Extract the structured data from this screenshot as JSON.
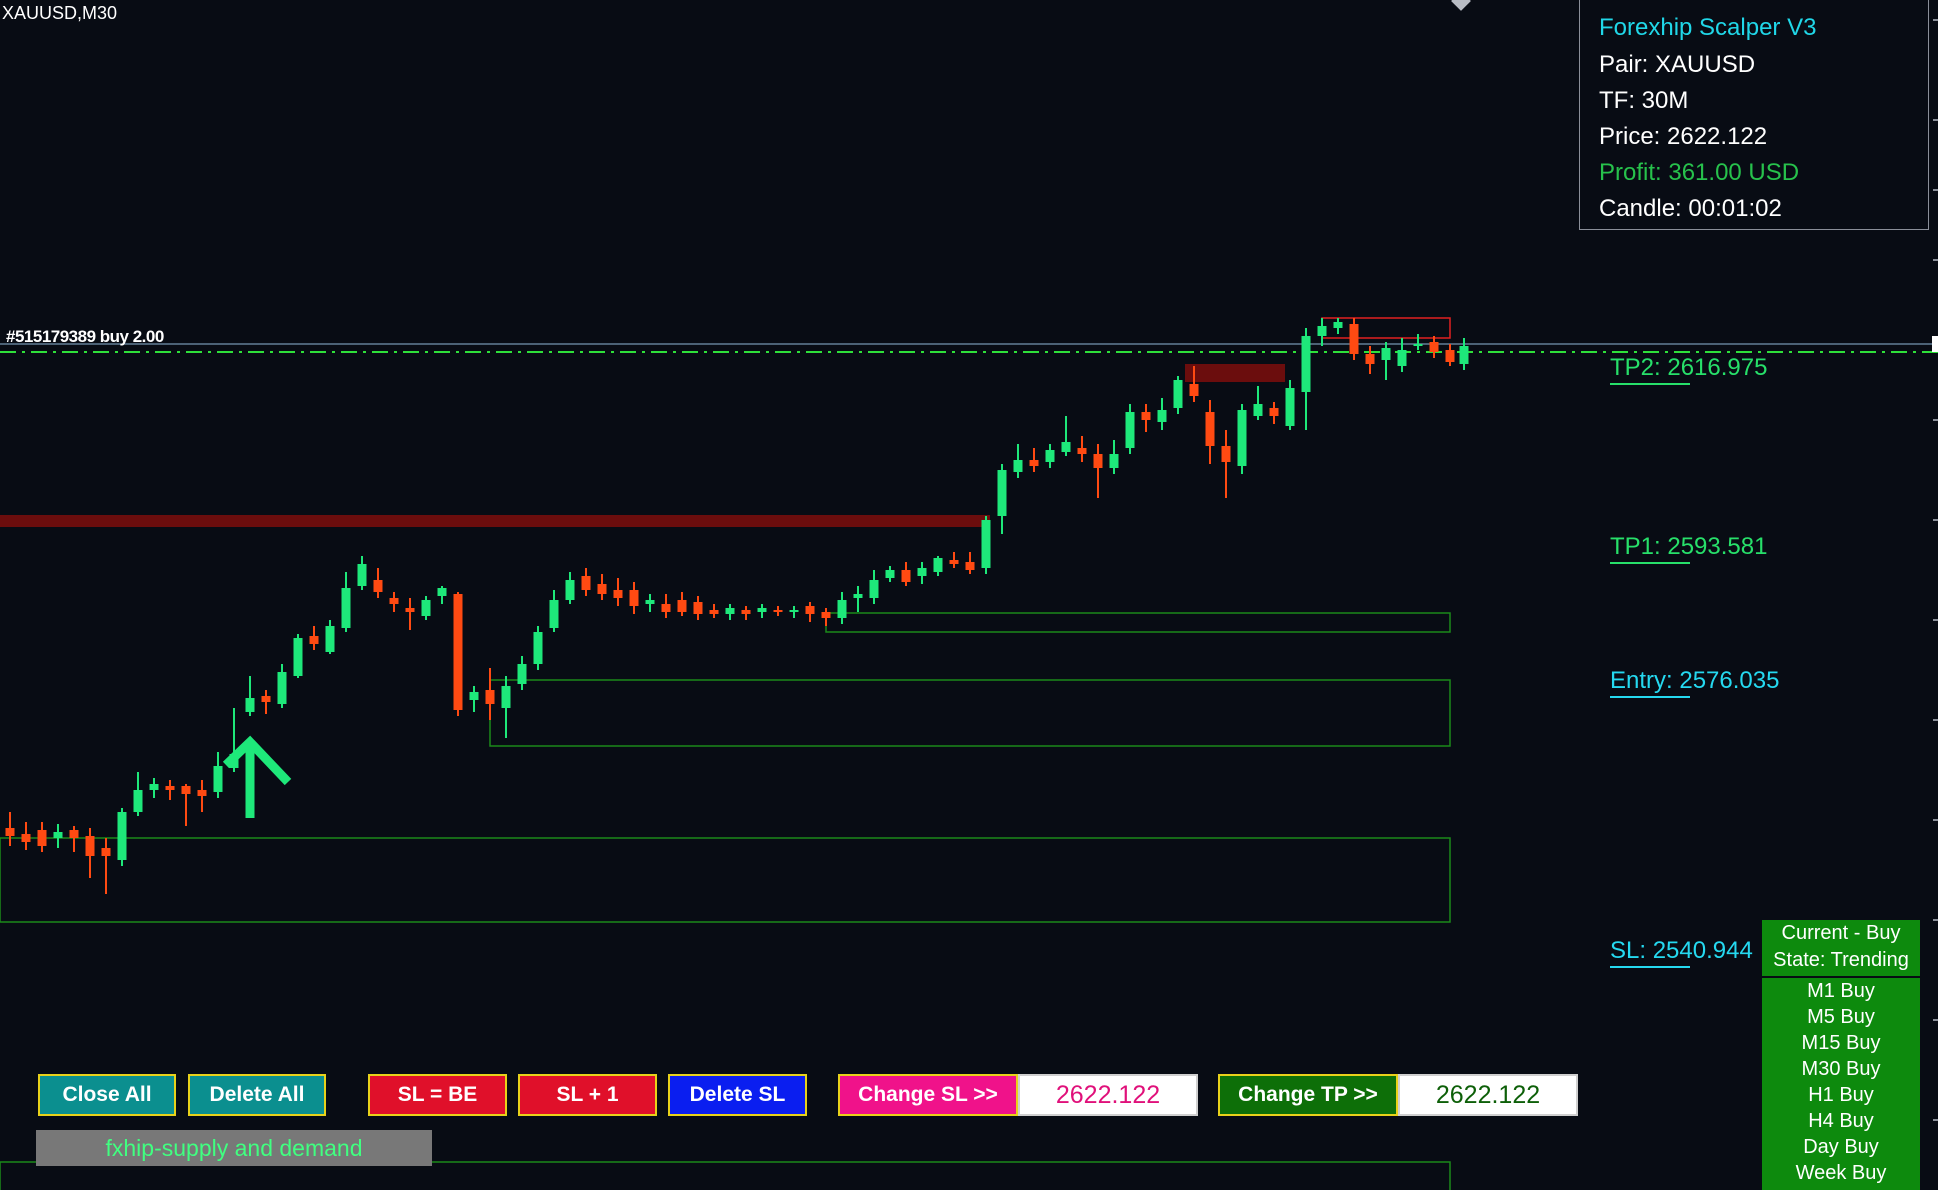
{
  "chart": {
    "symbol": "XAUUSD,M30",
    "order_label": "#515179389 buy 2.00",
    "colors": {
      "bull": "#1ee87a",
      "bear": "#ff4a12",
      "supply_zone": "#6b0d0d",
      "demand_zone": "#1a8a1a",
      "trade_line": "#2ee03a",
      "background": "#080c14"
    }
  },
  "info_panel": {
    "title": "Forexhip Scalper V3",
    "pair": "Pair: XAUUSD",
    "tf": "TF: 30M",
    "price": "Price: 2622.122",
    "profit": "Profit: 361.00 USD",
    "candle": "Candle: 00:01:02"
  },
  "levels": {
    "tp2": "TP2: 2616.975",
    "tp1": "TP1: 2593.581",
    "entry": "Entry: 2576.035",
    "sl": "SL: 2540.944"
  },
  "buttons": {
    "close_all": "Close All",
    "delete_all": "Delete All",
    "sl_be": "SL = BE",
    "sl_plus_one": "SL + 1",
    "delete_sl": "Delete SL",
    "change_sl": "Change SL >>",
    "change_sl_value": "2622.122",
    "change_tp": "Change TP >>",
    "change_tp_value": "2622.122",
    "indicator": "fxhip-supply and demand"
  },
  "state": {
    "current": "Current - Buy",
    "state": "State: Trending",
    "timeframes": [
      "M1 Buy",
      "M5 Buy",
      "M15 Buy",
      "M30 Buy",
      "H1 Buy",
      "H4 Buy",
      "Day Buy",
      "Week Buy"
    ]
  }
}
